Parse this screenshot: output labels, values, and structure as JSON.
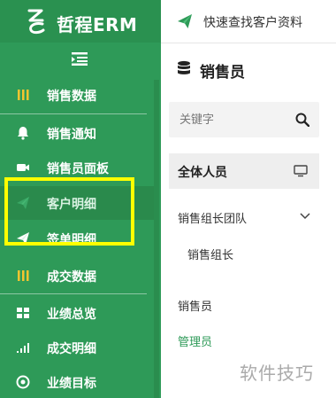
{
  "brand": {
    "title": "哲程ERM"
  },
  "sidebar": {
    "items": [
      {
        "label": "销售数据",
        "icon": "bars-icon"
      },
      {
        "label": "销售通知",
        "icon": "bell-icon"
      },
      {
        "label": "销售员面板",
        "icon": "video-icon"
      },
      {
        "label": "客户明细",
        "icon": "send-icon"
      },
      {
        "label": "签单明细",
        "icon": "send-icon"
      },
      {
        "label": "成交数据",
        "icon": "bars-icon"
      },
      {
        "label": "业绩总览",
        "icon": "grid-icon"
      },
      {
        "label": "成交明细",
        "icon": "signal-icon"
      },
      {
        "label": "业绩目标",
        "icon": "target-icon"
      }
    ]
  },
  "topbar": {
    "link": "快速查找客户资料"
  },
  "panel": {
    "title": "销售员",
    "search": {
      "placeholder": "关键字",
      "value": ""
    },
    "all_tab": "全体人员",
    "group": "销售组长团队",
    "group_child": "销售组长",
    "items": [
      "销售员",
      "管理员"
    ]
  },
  "watermark": "软件技巧",
  "colors": {
    "sidebar_bg": "#2e9a58",
    "accent": "#2e9a58",
    "highlight": "#ffff00"
  }
}
